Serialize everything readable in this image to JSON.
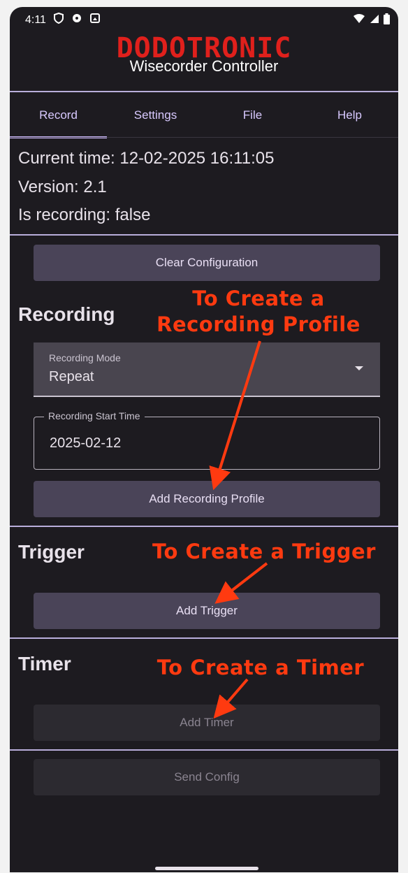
{
  "status_bar": {
    "time": "4:11",
    "left_icons": [
      "shield-icon",
      "notification-icon",
      "image-icon"
    ],
    "right_icons": [
      "wifi-icon",
      "signal-icon",
      "battery-icon"
    ]
  },
  "header": {
    "brand": "DODOTRONIC",
    "subtitle": "Wisecorder Controller",
    "brand_color": "#e0201c"
  },
  "tabs": [
    {
      "label": "Record",
      "active": true
    },
    {
      "label": "Settings",
      "active": false
    },
    {
      "label": "File",
      "active": false
    },
    {
      "label": "Help",
      "active": false
    }
  ],
  "info": {
    "current_time": "Current time: 12-02-2025 16:11:05",
    "version": "Version: 2.1",
    "is_recording": "Is recording: false"
  },
  "buttons": {
    "clear_config": "Clear Configuration",
    "add_recording_profile": "Add Recording Profile",
    "add_trigger": "Add Trigger",
    "add_timer": "Add Timer",
    "send_config": "Send Config"
  },
  "sections": {
    "recording": "Recording",
    "trigger": "Trigger",
    "timer": "Timer"
  },
  "fields": {
    "recording_mode": {
      "label": "Recording Mode",
      "value": "Repeat"
    },
    "recording_start_time": {
      "label": "Recording Start Time",
      "value": "2025-02-12"
    }
  },
  "annotations": {
    "recording_line1": "To Create a",
    "recording_line2": "Recording Profile",
    "trigger": "To Create a Trigger",
    "timer": "To Create a Timer",
    "color": "#ff3a10"
  },
  "colors": {
    "background": "#1d1b20",
    "tab_accent": "#d0bcff",
    "button": "#4a4458"
  }
}
